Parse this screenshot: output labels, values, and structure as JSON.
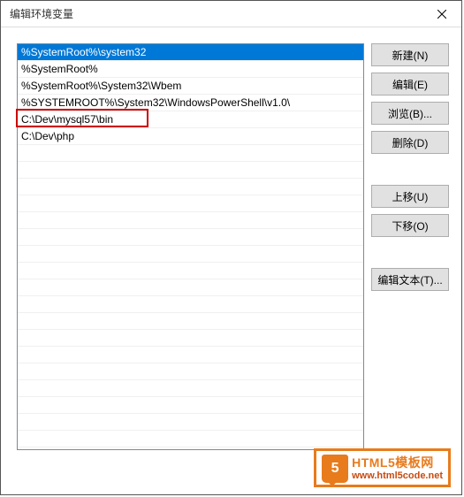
{
  "title": "编辑环境变量",
  "list": {
    "items": [
      "%SystemRoot%\\system32",
      "%SystemRoot%",
      "%SystemRoot%\\System32\\Wbem",
      "%SYSTEMROOT%\\System32\\WindowsPowerShell\\v1.0\\",
      "C:\\Dev\\mysql57\\bin",
      "C:\\Dev\\php"
    ],
    "selected_index": 0,
    "highlighted_index": 4
  },
  "buttons": {
    "new": "新建(N)",
    "edit": "编辑(E)",
    "browse": "浏览(B)...",
    "delete": "删除(D)",
    "move_up": "上移(U)",
    "move_down": "下移(O)",
    "edit_text": "编辑文本(T)..."
  },
  "watermark": {
    "badge": "5",
    "line1": "HTML5模板网",
    "line2": "www.html5code.net"
  }
}
